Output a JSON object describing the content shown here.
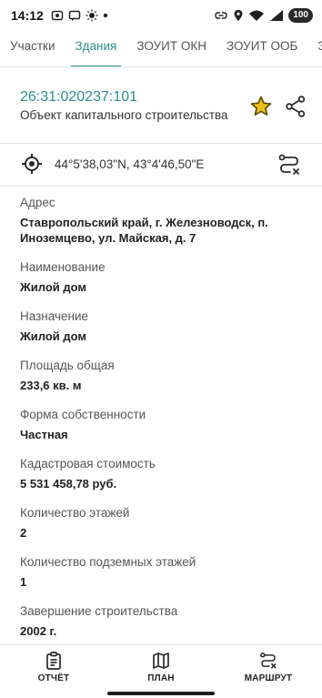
{
  "status_bar": {
    "time": "14:12",
    "battery": "100"
  },
  "tabs": [
    {
      "label": "Участки",
      "active": false
    },
    {
      "label": "Здания",
      "active": true
    },
    {
      "label": "ЗОУИТ ОКН",
      "active": false
    },
    {
      "label": "ЗОУИТ ООБ",
      "active": false
    },
    {
      "label": "З",
      "active": false
    }
  ],
  "object": {
    "cadastral_number": "26:31:020237:101",
    "type": "Объект капитального строительства"
  },
  "coordinates": "44°5'38,03\"N, 43°4'46,50\"E",
  "fields": [
    {
      "label": "Адрес",
      "value": "Ставропольский край, г. Железноводск, п. Иноземцево, ул. Майская, д. 7"
    },
    {
      "label": "Наименование",
      "value": "Жилой дом"
    },
    {
      "label": "Назначение",
      "value": "Жилой дом"
    },
    {
      "label": "Площадь общая",
      "value": "233,6 кв. м"
    },
    {
      "label": "Форма собственности",
      "value": "Частная"
    },
    {
      "label": "Кадастровая стоимость",
      "value": "5 531 458,78 руб."
    },
    {
      "label": "Количество этажей",
      "value": "2"
    },
    {
      "label": "Количество подземных этажей",
      "value": "1"
    },
    {
      "label": "Завершение строительства",
      "value": "2002 г."
    }
  ],
  "bottom_nav": {
    "report": "ОТЧЁТ",
    "plan": "ПЛАН",
    "route": "МАРШРУТ"
  },
  "colors": {
    "accent": "#2a8f8a",
    "star": "#d9b800"
  }
}
